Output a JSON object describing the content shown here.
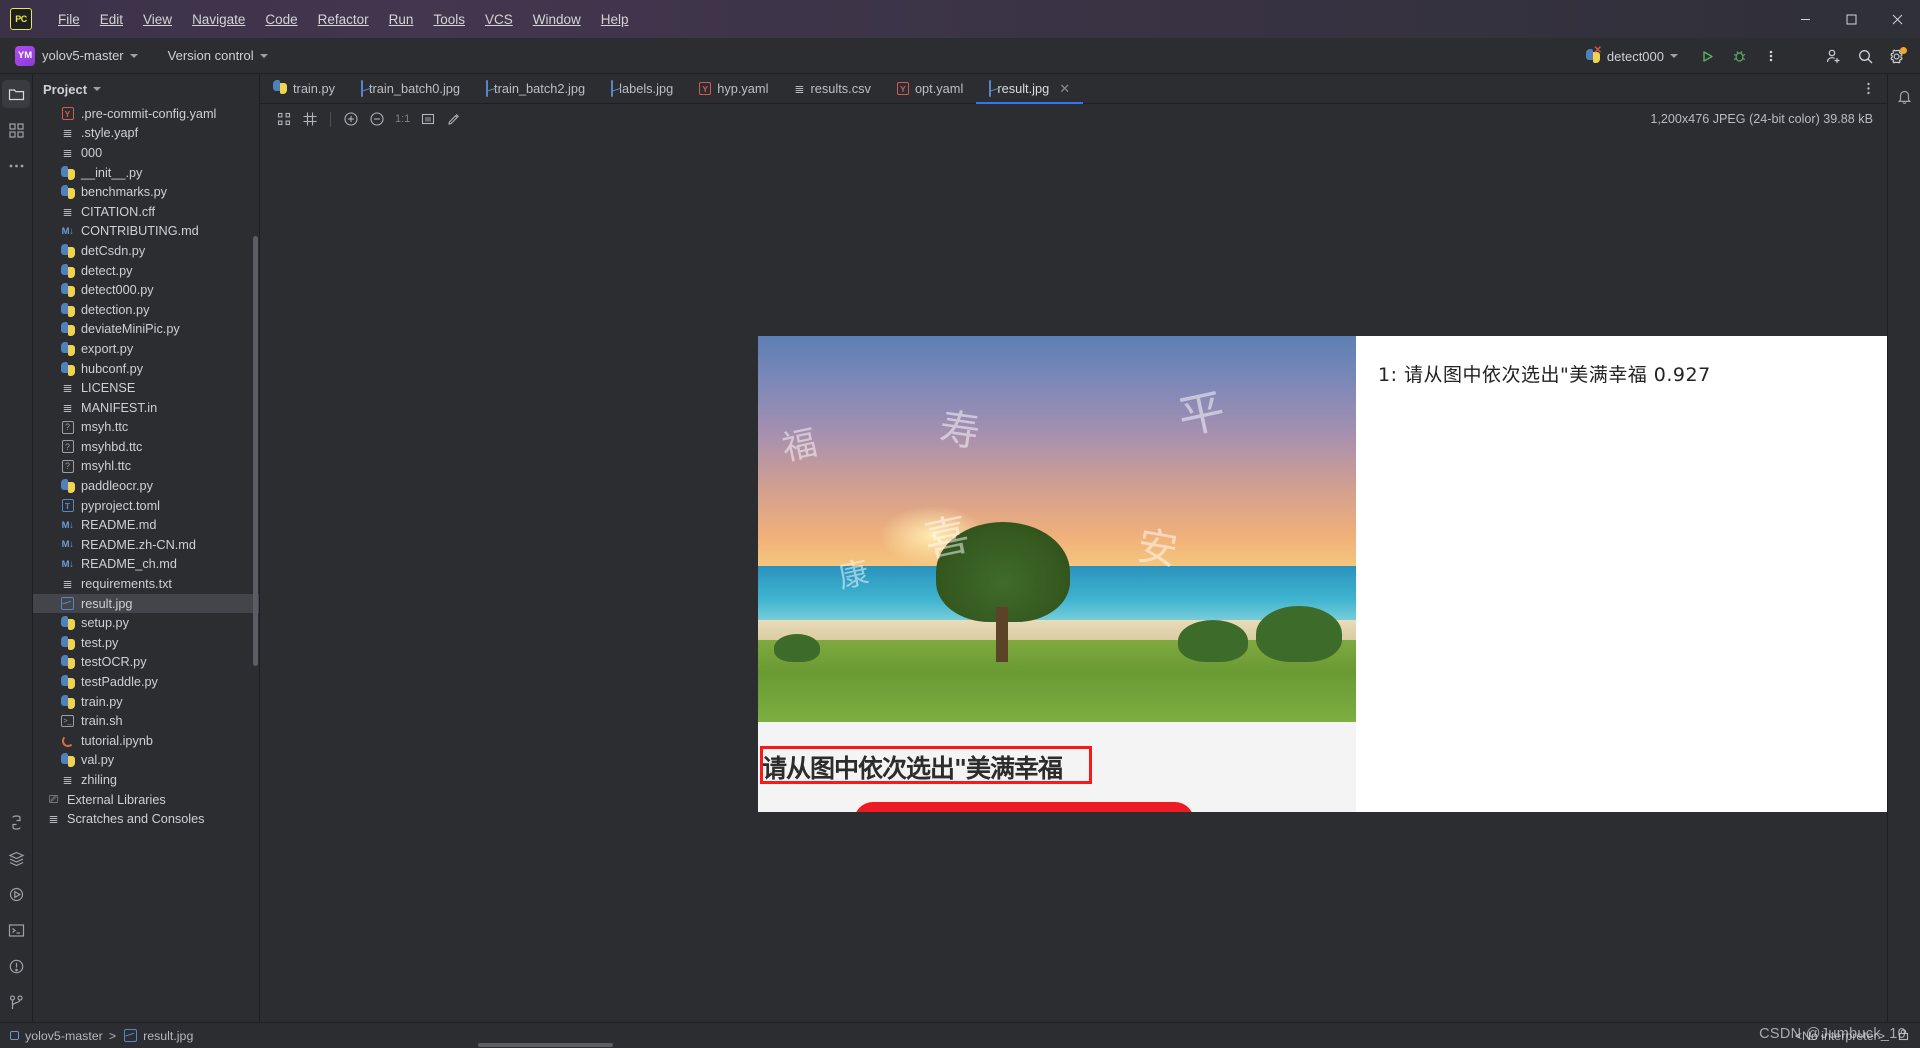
{
  "window": {
    "app_logo": "PC",
    "minimize": "minimize-icon",
    "maximize": "maximize-icon",
    "close": "close-icon"
  },
  "menu": {
    "items": [
      {
        "label": "File",
        "mnemonic": "F"
      },
      {
        "label": "Edit",
        "mnemonic": "E"
      },
      {
        "label": "View",
        "mnemonic": "V"
      },
      {
        "label": "Navigate",
        "mnemonic": "N"
      },
      {
        "label": "Code",
        "mnemonic": "C"
      },
      {
        "label": "Refactor",
        "mnemonic": "R"
      },
      {
        "label": "Run",
        "mnemonic": "u"
      },
      {
        "label": "Tools",
        "mnemonic": "T"
      },
      {
        "label": "VCS",
        "mnemonic": "S"
      },
      {
        "label": "Window",
        "mnemonic": "W"
      },
      {
        "label": "Help",
        "mnemonic": "H"
      }
    ]
  },
  "toolbar": {
    "project_badge": "YM",
    "project_name": "yolov5-master",
    "vcs_label": "Version control",
    "run_config": "detect000",
    "run_icon": "run-icon",
    "debug_icon": "debug-icon",
    "more_icon": "more-vertical-icon",
    "add_user_icon": "add-user-icon",
    "search_icon": "search-icon",
    "settings_icon": "gear-icon"
  },
  "rail": {
    "items": [
      {
        "name": "project-tool-window",
        "icon": "folder-icon",
        "active": true
      },
      {
        "name": "commit-tool-window",
        "icon": "commit-icon",
        "active": false
      },
      {
        "name": "more-tool-windows",
        "icon": "ellipsis-icon",
        "active": false
      }
    ],
    "bottom_items": [
      {
        "name": "python-packages",
        "icon": "python-icon"
      },
      {
        "name": "structure",
        "icon": "layers-icon"
      },
      {
        "name": "run-tool-window",
        "icon": "play-circle-icon"
      },
      {
        "name": "terminal-tool-window",
        "icon": "terminal-icon"
      },
      {
        "name": "problems-tool-window",
        "icon": "warning-circle-icon"
      },
      {
        "name": "version-control-tool-window",
        "icon": "branch-icon"
      }
    ]
  },
  "project": {
    "title": "Project",
    "files": [
      {
        "name": ".pre-commit-config.yaml",
        "icon": "yaml",
        "selected": false
      },
      {
        "name": ".style.yapf",
        "icon": "text",
        "selected": false
      },
      {
        "name": "000",
        "icon": "text",
        "selected": false
      },
      {
        "name": "__init__.py",
        "icon": "python",
        "selected": false
      },
      {
        "name": "benchmarks.py",
        "icon": "python",
        "selected": false
      },
      {
        "name": "CITATION.cff",
        "icon": "text",
        "selected": false
      },
      {
        "name": "CONTRIBUTING.md",
        "icon": "markdown",
        "selected": false
      },
      {
        "name": "detCsdn.py",
        "icon": "python",
        "selected": false
      },
      {
        "name": "detect.py",
        "icon": "python",
        "selected": false
      },
      {
        "name": "detect000.py",
        "icon": "python",
        "selected": false
      },
      {
        "name": "detection.py",
        "icon": "python",
        "selected": false
      },
      {
        "name": "deviateMiniPic.py",
        "icon": "python",
        "selected": false
      },
      {
        "name": "export.py",
        "icon": "python",
        "selected": false
      },
      {
        "name": "hubconf.py",
        "icon": "python",
        "selected": false
      },
      {
        "name": "LICENSE",
        "icon": "text",
        "selected": false
      },
      {
        "name": "MANIFEST.in",
        "icon": "text",
        "selected": false
      },
      {
        "name": "msyh.ttc",
        "icon": "unknown",
        "selected": false
      },
      {
        "name": "msyhbd.ttc",
        "icon": "unknown",
        "selected": false
      },
      {
        "name": "msyhl.ttc",
        "icon": "unknown",
        "selected": false
      },
      {
        "name": "paddleocr.py",
        "icon": "python",
        "selected": false
      },
      {
        "name": "pyproject.toml",
        "icon": "toml",
        "selected": false
      },
      {
        "name": "README.md",
        "icon": "markdown",
        "selected": false
      },
      {
        "name": "README.zh-CN.md",
        "icon": "markdown",
        "selected": false
      },
      {
        "name": "README_ch.md",
        "icon": "markdown",
        "selected": false
      },
      {
        "name": "requirements.txt",
        "icon": "text",
        "selected": false
      },
      {
        "name": "result.jpg",
        "icon": "image",
        "selected": true
      },
      {
        "name": "setup.py",
        "icon": "python",
        "selected": false
      },
      {
        "name": "test.py",
        "icon": "python",
        "selected": false
      },
      {
        "name": "testOCR.py",
        "icon": "python",
        "selected": false
      },
      {
        "name": "testPaddle.py",
        "icon": "python",
        "selected": false
      },
      {
        "name": "train.py",
        "icon": "python",
        "selected": false
      },
      {
        "name": "train.sh",
        "icon": "shell",
        "selected": false
      },
      {
        "name": "tutorial.ipynb",
        "icon": "notebook",
        "selected": false
      },
      {
        "name": "val.py",
        "icon": "python",
        "selected": false
      },
      {
        "name": "zhiling",
        "icon": "text",
        "selected": false
      }
    ],
    "roots": [
      {
        "name": "External Libraries",
        "icon": "library"
      },
      {
        "name": "Scratches and Consoles",
        "icon": "scratches"
      }
    ]
  },
  "tabs": [
    {
      "label": "train.py",
      "icon": "python",
      "active": false,
      "closable": false
    },
    {
      "label": "train_batch0.jpg",
      "icon": "image",
      "active": false,
      "closable": false
    },
    {
      "label": "train_batch2.jpg",
      "icon": "image",
      "active": false,
      "closable": false
    },
    {
      "label": "labels.jpg",
      "icon": "image",
      "active": false,
      "closable": false
    },
    {
      "label": "hyp.yaml",
      "icon": "yaml",
      "active": false,
      "closable": false
    },
    {
      "label": "results.csv",
      "icon": "text",
      "active": false,
      "closable": false
    },
    {
      "label": "opt.yaml",
      "icon": "yaml",
      "active": false,
      "closable": false
    },
    {
      "label": "result.jpg",
      "icon": "image",
      "active": true,
      "closable": true
    }
  ],
  "image_viewer": {
    "toolbar": {
      "transparency_icon": "transparency-grid-icon",
      "grid_icon": "grid-icon",
      "zoom_in_icon": "zoom-in-icon",
      "zoom_out_icon": "zoom-out-icon",
      "actual_size_label": "1:1",
      "fit_icon": "fit-to-window-icon",
      "color_picker_icon": "color-picker-icon"
    },
    "info": "1,200x476 JPEG (24-bit color) 39.88 kB",
    "close_icon": "close-icon"
  },
  "image_content": {
    "detection_line": "1: 请从图中依次选出\"美满幸福    0.927",
    "detection_index": "1:",
    "detection_text": "请从图中依次选出\"美满幸福",
    "confidence": "0.927",
    "boxed_text": "请从图中依次选出\"美满幸福",
    "box_color": "#f51b1b",
    "photo_watermarks": [
      "福",
      "寿",
      "平",
      "喜",
      "安",
      "康"
    ]
  },
  "status_bar": {
    "breadcrumb_root": "yolov5-master",
    "breadcrumb_separator": ">",
    "breadcrumb_file": "result.jpg",
    "interpreter": "<No interpreter>",
    "watermark": "CSDN @Jumbuck_10"
  }
}
